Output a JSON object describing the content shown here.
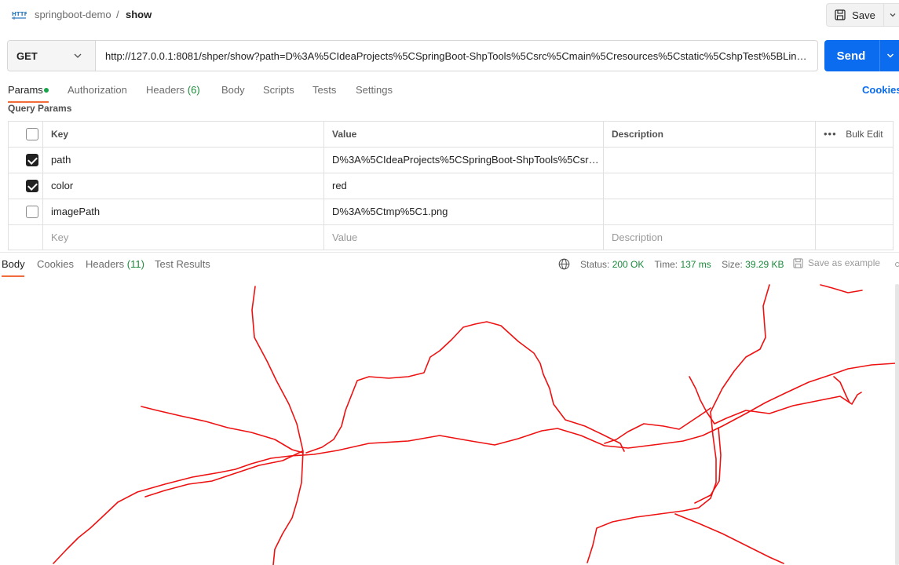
{
  "header": {
    "collection": "springboot-demo",
    "separator": "/",
    "request_name": "show",
    "save_label": "Save"
  },
  "request": {
    "method": "GET",
    "url": "http://127.0.0.1:8081/shper/show?path=D%3A%5CIdeaProjects%5CSpringBoot-ShpTools%5Csrc%5Cmain%5Cresources%5Cstatic%5CshpTest%5BLineString'...",
    "send_label": "Send"
  },
  "request_tabs": {
    "params": "Params",
    "authorization": "Authorization",
    "headers": "Headers",
    "headers_count": "(6)",
    "body": "Body",
    "scripts": "Scripts",
    "tests": "Tests",
    "settings": "Settings",
    "cookies": "Cookies"
  },
  "query_params": {
    "title": "Query Params",
    "columns": {
      "key": "Key",
      "value": "Value",
      "description": "Description",
      "bulk_edit": "Bulk Edit"
    },
    "rows": [
      {
        "checked": true,
        "key": "path",
        "value": "D%3A%5CIdeaProjects%5CSpringBoot-ShpTools%5Csrc%...",
        "description": ""
      },
      {
        "checked": true,
        "key": "color",
        "value": "red",
        "description": ""
      },
      {
        "checked": false,
        "key": "imagePath",
        "value": "D%3A%5Ctmp%5C1.png",
        "description": ""
      }
    ],
    "placeholders": {
      "key": "Key",
      "value": "Value",
      "description": "Description"
    }
  },
  "response": {
    "tabs": {
      "body": "Body",
      "cookies": "Cookies",
      "headers": "Headers",
      "headers_count": "(11)",
      "test_results": "Test Results"
    },
    "status_label": "Status:",
    "status_value": "200 OK",
    "time_label": "Time:",
    "time_value": "137 ms",
    "size_label": "Size:",
    "size_value": "39.29 KB",
    "save_example": "Save as example",
    "line_color": "#ee1111"
  },
  "colors": {
    "accent": "#0b6cf0",
    "tab_underline": "#f26b3a",
    "success": "#1a8a3a"
  }
}
